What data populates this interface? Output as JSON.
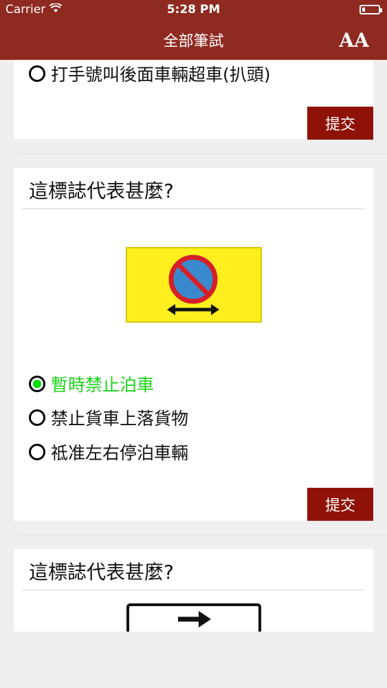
{
  "status": {
    "carrier": "Carrier",
    "time": "5:28 PM"
  },
  "nav": {
    "title": "全部筆試",
    "font_button": "AA"
  },
  "questions": [
    {
      "options": [
        {
          "label": "打手號叫後面車輛超車(扒頭)",
          "selected": false
        }
      ],
      "submit_label": "提交"
    },
    {
      "question": "這標誌代表甚麼?",
      "sign_icon": "no-parking-temporary-sign",
      "options": [
        {
          "label": "暫時禁止泊車",
          "selected": true
        },
        {
          "label": "禁止貨車上落貨物",
          "selected": false
        },
        {
          "label": "祗准左右停泊車輛",
          "selected": false
        }
      ],
      "submit_label": "提交",
      "colors": {
        "sign_bg": "#ffef1e",
        "ring": "#d61f26",
        "blue": "#3a89cf"
      }
    },
    {
      "question": "這標誌代表甚麼?",
      "sign_icon": "right-arrow-sign"
    }
  ],
  "colors": {
    "brand": "#8f2a21",
    "submit": "#8f1207",
    "selected_text": "#19d419"
  }
}
